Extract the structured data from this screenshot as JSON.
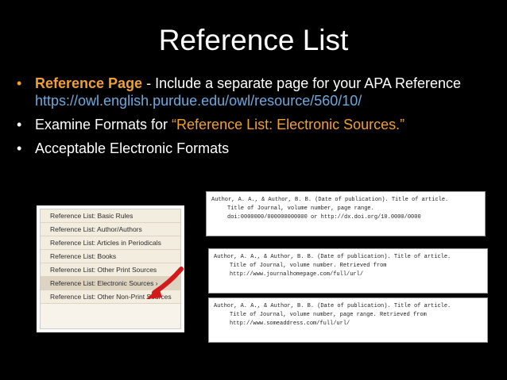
{
  "title": "Reference List",
  "bullets": {
    "b1_highlight": "Reference Page",
    "b1_text": " - Include a separate page for your APA Reference",
    "b1_link": "https://owl.english.purdue.edu/owl/resource/560/10/",
    "b2_text": "Examine Formats for ",
    "b2_highlight": "“Reference List: Electronic Sources.”",
    "b3_text": "Acceptable Electronic Formats"
  },
  "menu": {
    "items": [
      "Reference List: Basic Rules",
      "Reference List: Author/Authors",
      "Reference List: Articles in Periodicals",
      "Reference List: Books",
      "Reference List: Other Print Sources",
      "Reference List: Electronic Sources ›",
      "Reference List: Other Non-Print Sources"
    ]
  },
  "citations": [
    {
      "line1": "Author, A. A., & Author, B. B. (Date of publication). Title of article.",
      "line2": "Title of Journal, volume number, page range.",
      "line3": "doi:0000000/000000000000 or http://dx.doi.org/10.0000/0000"
    },
    {
      "line1": "Author, A. A., & Author, B. B. (Date of publication). Title of article.",
      "line2": "Title of Journal, volume number. Retrieved from",
      "line3": "http://www.journalhomepage.com/full/url/"
    },
    {
      "line1": "Author, A. A., & Author, B. B. (Date of publication). Title of article.",
      "line2": "Title of Journal, volume number, page range. Retrieved from",
      "line3": "http://www.someaddress.com/full/url/"
    }
  ],
  "colors": {
    "accent": "#f0a030",
    "link": "#6fa8dc",
    "background": "#000000"
  }
}
